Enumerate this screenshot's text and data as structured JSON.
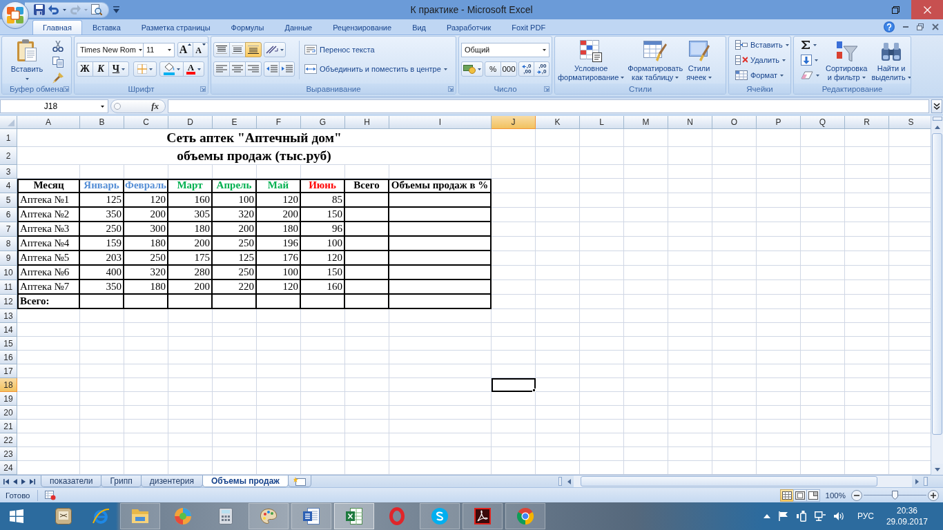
{
  "window": {
    "title": "К практике - Microsoft Excel"
  },
  "ribbon_tabs": [
    {
      "label": "Главная",
      "selected": true
    },
    {
      "label": "Вставка",
      "selected": false
    },
    {
      "label": "Разметка страницы",
      "selected": false
    },
    {
      "label": "Формулы",
      "selected": false
    },
    {
      "label": "Данные",
      "selected": false
    },
    {
      "label": "Рецензирование",
      "selected": false
    },
    {
      "label": "Вид",
      "selected": false
    },
    {
      "label": "Разработчик",
      "selected": false
    },
    {
      "label": "Foxit PDF",
      "selected": false
    }
  ],
  "ribbon": {
    "clipboard": {
      "title": "Буфер обмена",
      "paste": "Вставить"
    },
    "font": {
      "title": "Шрифт",
      "font_name": "Times New Rom",
      "font_size": "11",
      "grow": "A",
      "shrink": "A",
      "bold": "Ж",
      "italic": "К",
      "underline": "Ч",
      "font_color": "A"
    },
    "alignment": {
      "title": "Выравнивание",
      "vertical": [
        {
          "kind": "top",
          "selected": false
        },
        {
          "kind": "middle",
          "selected": false
        },
        {
          "kind": "bottom",
          "selected": true
        }
      ],
      "horizontal": [
        {
          "kind": "left",
          "selected": false
        },
        {
          "kind": "center",
          "selected": false
        },
        {
          "kind": "right",
          "selected": false
        }
      ],
      "wrap_text": "Перенос текста",
      "merge_center": "Объединить и поместить в центре"
    },
    "number": {
      "title": "Число",
      "format": "Общий",
      "percent": "%",
      "thousands": "000",
      "increase_decimal": [
        ",0",
        ",00"
      ],
      "decrease_decimal": [
        ",00",
        ",0"
      ]
    },
    "styles": {
      "title": "Стили",
      "buttons": [
        {
          "kind": "conditional",
          "lines": [
            "Условное",
            "форматирование"
          ]
        },
        {
          "kind": "table",
          "lines": [
            "Форматировать",
            "как таблицу"
          ]
        },
        {
          "kind": "cell_styles",
          "lines": [
            "Стили",
            "ячеек"
          ]
        }
      ]
    },
    "cells": {
      "title": "Ячейки",
      "buttons": [
        {
          "kind": "insert",
          "label": "Вставить"
        },
        {
          "kind": "delete",
          "label": "Удалить"
        },
        {
          "kind": "format",
          "label": "Формат"
        }
      ]
    },
    "editing": {
      "title": "Редактирование",
      "buttons": [
        {
          "kind": "sort",
          "lines": [
            "Сортировка",
            "и фильтр"
          ]
        },
        {
          "kind": "find",
          "lines": [
            "Найти и",
            "выделить"
          ]
        }
      ]
    }
  },
  "formula_bar": {
    "name_box": "J18",
    "function_button": "fx"
  },
  "sheet": {
    "columns": [
      {
        "label": "A",
        "selected": false
      },
      {
        "label": "B",
        "selected": false
      },
      {
        "label": "C",
        "selected": false
      },
      {
        "label": "D",
        "selected": false
      },
      {
        "label": "E",
        "selected": false
      },
      {
        "label": "F",
        "selected": false
      },
      {
        "label": "G",
        "selected": false
      },
      {
        "label": "H",
        "selected": false
      },
      {
        "label": "I",
        "selected": false
      },
      {
        "label": "J",
        "selected": true
      },
      {
        "label": "K",
        "selected": false
      },
      {
        "label": "L",
        "selected": false
      },
      {
        "label": "M",
        "selected": false
      },
      {
        "label": "N",
        "selected": false
      },
      {
        "label": "O",
        "selected": false
      },
      {
        "label": "P",
        "selected": false
      },
      {
        "label": "Q",
        "selected": false
      },
      {
        "label": "R",
        "selected": false
      },
      {
        "label": "S",
        "selected": false
      }
    ],
    "rows": [
      {
        "label": "1",
        "selected": false
      },
      {
        "label": "2",
        "selected": false
      },
      {
        "label": "3",
        "selected": false
      },
      {
        "label": "4",
        "selected": false
      },
      {
        "label": "5",
        "selected": false
      },
      {
        "label": "6",
        "selected": false
      },
      {
        "label": "7",
        "selected": false
      },
      {
        "label": "8",
        "selected": false
      },
      {
        "label": "9",
        "selected": false
      },
      {
        "label": "10",
        "selected": false
      },
      {
        "label": "11",
        "selected": false
      },
      {
        "label": "12",
        "selected": false
      },
      {
        "label": "13",
        "selected": false
      },
      {
        "label": "14",
        "selected": false
      },
      {
        "label": "15",
        "selected": false
      },
      {
        "label": "16",
        "selected": false
      },
      {
        "label": "17",
        "selected": false
      },
      {
        "label": "18",
        "selected": true
      },
      {
        "label": "19",
        "selected": false
      },
      {
        "label": "20",
        "selected": false
      },
      {
        "label": "21",
        "selected": false
      },
      {
        "label": "22",
        "selected": false
      },
      {
        "label": "23",
        "selected": false
      },
      {
        "label": "24",
        "selected": false
      }
    ],
    "title": "Сеть аптек \"Аптечный дом\"",
    "subtitle": "объемы продаж (тыс.руб)",
    "table": {
      "header": [
        {
          "text": "Месяц",
          "color": "#000000"
        },
        {
          "text": "Январь",
          "color": "#558ed5"
        },
        {
          "text": "Февраль",
          "color": "#558ed5"
        },
        {
          "text": "Март",
          "color": "#00b050"
        },
        {
          "text": "Апрель",
          "color": "#00b050"
        },
        {
          "text": "Май",
          "color": "#00b050"
        },
        {
          "text": "Июнь",
          "color": "#ff0000"
        },
        {
          "text": "Всего",
          "color": "#000000"
        },
        {
          "text": "Объемы продаж в %",
          "color": "#000000"
        }
      ],
      "rows": [
        {
          "name": "Аптека №1",
          "values": [
            "125",
            "120",
            "160",
            "100",
            "120",
            "85"
          ]
        },
        {
          "name": "Аптека №2",
          "values": [
            "350",
            "200",
            "305",
            "320",
            "200",
            "150"
          ]
        },
        {
          "name": "Аптека №3",
          "values": [
            "250",
            "300",
            "180",
            "200",
            "180",
            "96"
          ]
        },
        {
          "name": "Аптека №4",
          "values": [
            "159",
            "180",
            "200",
            "250",
            "196",
            "100"
          ]
        },
        {
          "name": "Аптека №5",
          "values": [
            "203",
            "250",
            "175",
            "125",
            "176",
            "120"
          ]
        },
        {
          "name": "Аптека №6",
          "values": [
            "400",
            "320",
            "280",
            "250",
            "100",
            "150"
          ]
        },
        {
          "name": "Аптека №7",
          "values": [
            "350",
            "180",
            "200",
            "220",
            "120",
            "160"
          ]
        }
      ],
      "total_label": "Всего:"
    }
  },
  "sheet_tabs": [
    {
      "label": "показатели",
      "selected": false
    },
    {
      "label": "Грипп",
      "selected": false
    },
    {
      "label": "дизентерия",
      "selected": false
    },
    {
      "label": "Объемы продаж",
      "selected": true
    }
  ],
  "status_bar": {
    "status": "Готово",
    "views": [
      {
        "kind": "normal",
        "selected": true
      },
      {
        "kind": "page_layout",
        "selected": false
      },
      {
        "kind": "page_break",
        "selected": false
      }
    ],
    "zoom": "100%",
    "zoom_slider": {
      "level": 0.5
    }
  },
  "taskbar": {
    "apps": [
      {
        "kind": "notes",
        "running": false,
        "active": false
      },
      {
        "kind": "browser",
        "running": false,
        "active": false
      },
      {
        "kind": "folder",
        "running": true,
        "active": false
      },
      {
        "kind": "media",
        "running": false,
        "active": false
      },
      {
        "kind": "calculator",
        "running": false,
        "active": false
      },
      {
        "kind": "paint",
        "running": true,
        "active": false
      },
      {
        "kind": "document",
        "running": true,
        "active": false
      },
      {
        "kind": "spreadsheet",
        "running": true,
        "active": true
      },
      {
        "kind": "ring",
        "running": false,
        "active": false
      },
      {
        "kind": "chat",
        "running": true,
        "active": false
      },
      {
        "kind": "pdf",
        "running": true,
        "active": false
      },
      {
        "kind": "tricolor",
        "running": true,
        "active": false
      }
    ],
    "tray": {
      "language": "РУС",
      "time": "20:36",
      "date": "29.09.2017"
    }
  }
}
